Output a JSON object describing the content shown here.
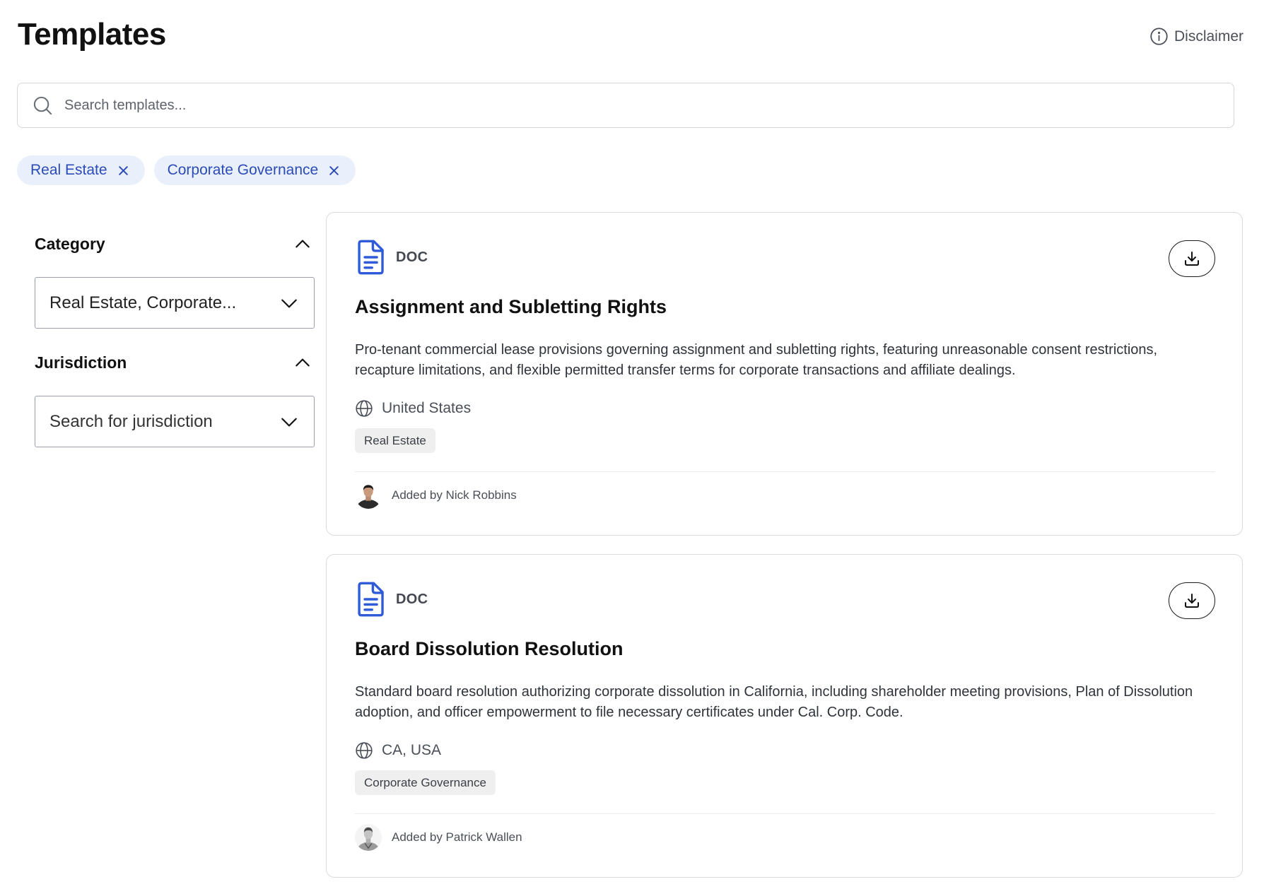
{
  "header": {
    "title": "Templates",
    "disclaimer_label": "Disclaimer"
  },
  "search": {
    "placeholder": "Search templates..."
  },
  "active_filters": [
    {
      "label": "Real Estate"
    },
    {
      "label": "Corporate Governance"
    }
  ],
  "sidebar": {
    "category": {
      "title": "Category",
      "value": "Real Estate, Corporate..."
    },
    "jurisdiction": {
      "title": "Jurisdiction",
      "placeholder": "Search for jurisdiction"
    }
  },
  "templates": [
    {
      "type": "DOC",
      "title": "Assignment and Subletting Rights",
      "description": "Pro-tenant commercial lease provisions governing assignment and subletting rights, featuring unreasonable consent restrictions, recapture limitations, and flexible permitted transfer terms for corporate transactions and affiliate dealings.",
      "location": "United States",
      "tag": "Real Estate",
      "added_by": "Added by Nick Robbins"
    },
    {
      "type": "DOC",
      "title": "Board Dissolution Resolution",
      "description": "Standard board resolution authorizing corporate dissolution in California, including shareholder meeting provisions, Plan of Dissolution adoption, and officer empowerment to file necessary certificates under Cal. Corp. Code.",
      "location": "CA, USA",
      "tag": "Corporate Governance",
      "added_by": "Added by Patrick Wallen"
    }
  ],
  "colors": {
    "accent": "#2b4bb8",
    "chip_bg": "#eaf0fb",
    "doc_icon": "#2f5bd8",
    "tag_bg": "#efefef"
  },
  "icons": {
    "disclaimer": "info-icon",
    "search": "search-icon",
    "chip_remove": "close-icon",
    "collapse": "chevron-up-icon",
    "dropdown": "chevron-down-icon",
    "document": "document-icon",
    "download": "download-icon",
    "location": "globe-icon"
  }
}
